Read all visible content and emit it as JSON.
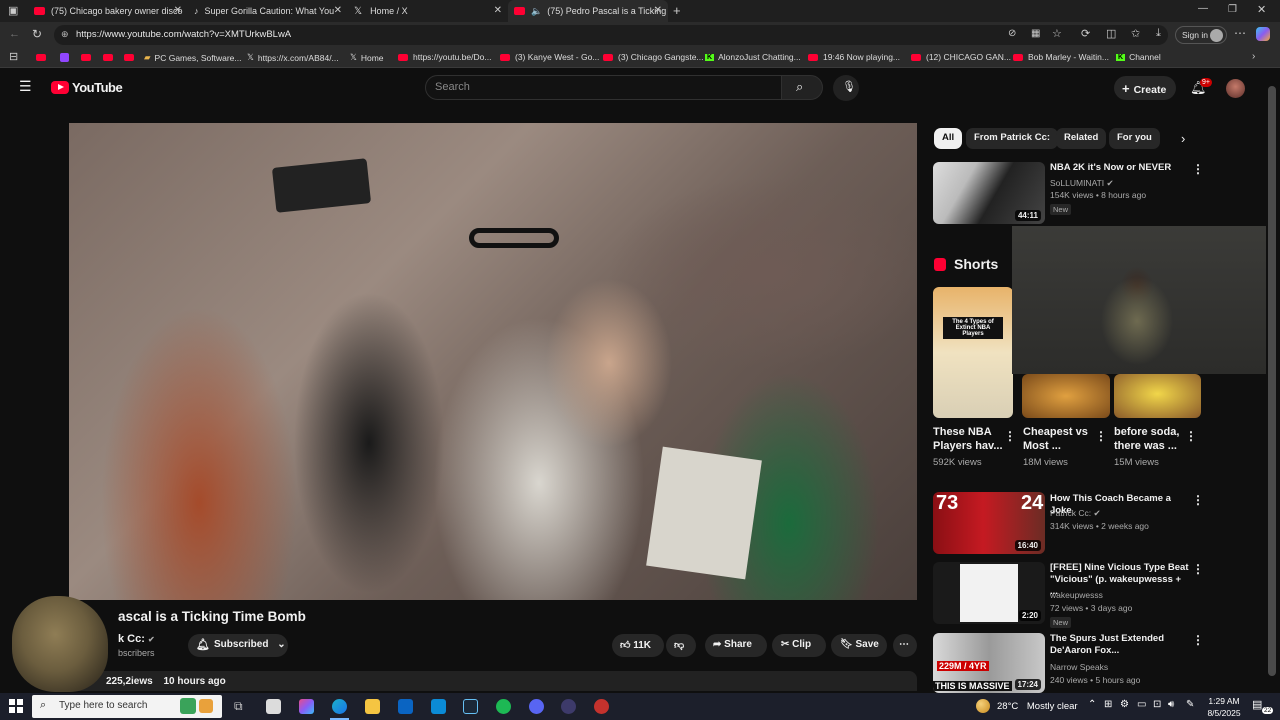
{
  "browser": {
    "tabs": [
      {
        "label": "(75) Chicago bakery owner disco",
        "icon": "youtube"
      },
      {
        "label": "Super Gorilla Caution: What You",
        "icon": "tiktok"
      },
      {
        "label": "Home / X",
        "icon": "x"
      },
      {
        "label": "(75) Pedro Pascal is a Ticking",
        "icon": "youtube"
      }
    ],
    "url": "https://www.youtube.com/watch?v=XMTUrkwBLwA",
    "sign_in": "Sign in",
    "bookmarks": [
      {
        "label": "PC Games, Software..."
      },
      {
        "label": "https://x.com/AB84/..."
      },
      {
        "label": "Home"
      },
      {
        "label": "https://youtu.be/Do..."
      },
      {
        "label": "(3) Kanye West - Go..."
      },
      {
        "label": "(3) Chicago Gangste..."
      },
      {
        "label": "AlonzoJust Chatting..."
      },
      {
        "label": "19:46 Now playing..."
      },
      {
        "label": "(12) CHICAGO GAN..."
      },
      {
        "label": "Bob Marley - Waitin..."
      },
      {
        "label": "Channel"
      }
    ]
  },
  "youtube": {
    "logo": "YouTube",
    "search_placeholder": "Search",
    "create_label": "Create",
    "notif_count": "9+",
    "video": {
      "title": "Pedro Pascal is a Ticking Time Bomb",
      "title_visible": "ascal is a Ticking Time Bomb",
      "channel_visible": "k Cc:",
      "subs_visible": "bscribers",
      "subscribed_label": "Subscribed",
      "likes": "11K",
      "share_label": "Share",
      "clip_label": "Clip",
      "save_label": "Save",
      "views_visible": "225,2",
      "views_suffix": "iews",
      "age": "10 hours ago"
    },
    "chips": [
      "All",
      "From Patrick Cc:",
      "Related",
      "For you"
    ],
    "recommended": [
      {
        "title": "NBA 2K it's Now or NEVER",
        "channel": "SoLLUMINATI",
        "meta": "154K views • 8 hours ago",
        "duration": "44:11",
        "badge": "New"
      },
      {
        "title": "How This Coach Became a Joke",
        "channel": "Patrick Cc:",
        "meta": "314K views • 2 weeks ago",
        "duration": "16:40",
        "badge": ""
      },
      {
        "title": "[FREE] Nine Vicious Type Beat \"Vicious\" (p. wakeupwesss + ...",
        "channel": "wakeupwesss",
        "meta": "72 views • 3 days ago",
        "duration": "2:20",
        "badge": "New"
      },
      {
        "title": "The Spurs Just Extended De'Aaron Fox...",
        "channel": "Narrow Speaks",
        "meta": "240 views • 5 hours ago",
        "duration": "17:24",
        "badge": ""
      }
    ],
    "shorts_label": "Shorts",
    "shorts": [
      {
        "title": "These NBA Players hav...",
        "views": "592K views",
        "overlay": "The 4 Types of Extinct NBA Players"
      },
      {
        "title": "Cheapest vs Most ...",
        "views": "18M views"
      },
      {
        "title": "before soda, there was ...",
        "views": "15M views"
      }
    ],
    "thumb_texts": {
      "coach_big": "73",
      "coach_big2": "24",
      "spurs_big": "229M / 4YR",
      "spurs_bottom": "THIS IS MASSIVE"
    }
  },
  "taskbar": {
    "search_placeholder": "Type here to search",
    "weather_temp": "28°C",
    "weather_desc": "Mostly clear",
    "time": "1:29 AM",
    "date": "8/5/2025",
    "notif_count": "22"
  },
  "colors": {
    "yt_red": "#ff0033",
    "bg": "#0f0f0f",
    "chip": "#272727"
  }
}
